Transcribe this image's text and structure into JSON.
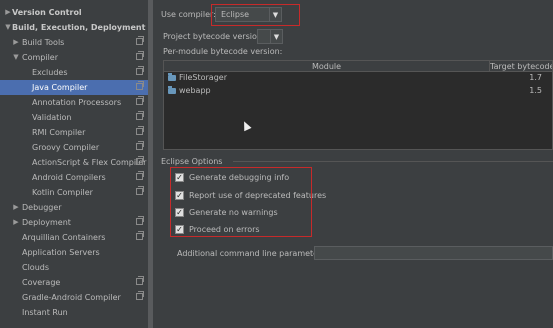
{
  "sidebar": {
    "items": [
      {
        "label": "Version Control",
        "arrow": "▶",
        "bold": true,
        "copy": false
      },
      {
        "label": "Build, Execution, Deployment",
        "arrow": "▼",
        "bold": true,
        "copy": false
      },
      {
        "label": "Build Tools",
        "arrow": "▶",
        "bold": false,
        "copy": true
      },
      {
        "label": "Compiler",
        "arrow": "▼",
        "bold": false,
        "copy": true
      },
      {
        "label": "Excludes",
        "arrow": "",
        "bold": false,
        "copy": true
      },
      {
        "label": "Java Compiler",
        "arrow": "",
        "bold": false,
        "copy": true,
        "selected": true
      },
      {
        "label": "Annotation Processors",
        "arrow": "",
        "bold": false,
        "copy": true
      },
      {
        "label": "Validation",
        "arrow": "",
        "bold": false,
        "copy": true
      },
      {
        "label": "RMI Compiler",
        "arrow": "",
        "bold": false,
        "copy": true
      },
      {
        "label": "Groovy Compiler",
        "arrow": "",
        "bold": false,
        "copy": true
      },
      {
        "label": "ActionScript & Flex Compiler",
        "arrow": "",
        "bold": false,
        "copy": true
      },
      {
        "label": "Android Compilers",
        "arrow": "",
        "bold": false,
        "copy": true
      },
      {
        "label": "Kotlin Compiler",
        "arrow": "",
        "bold": false,
        "copy": true
      },
      {
        "label": "Debugger",
        "arrow": "▶",
        "bold": false,
        "copy": false
      },
      {
        "label": "Deployment",
        "arrow": "▶",
        "bold": false,
        "copy": true
      },
      {
        "label": "Arquillian Containers",
        "arrow": "",
        "bold": false,
        "copy": true
      },
      {
        "label": "Application Servers",
        "arrow": "",
        "bold": false,
        "copy": false
      },
      {
        "label": "Clouds",
        "arrow": "",
        "bold": false,
        "copy": false
      },
      {
        "label": "Coverage",
        "arrow": "",
        "bold": false,
        "copy": true
      },
      {
        "label": "Gradle-Android Compiler",
        "arrow": "",
        "bold": false,
        "copy": true
      },
      {
        "label": "Instant Run",
        "arrow": "",
        "bold": false,
        "copy": false
      }
    ]
  },
  "main": {
    "use_compiler_label": "Use compiler:",
    "compiler_value": "Eclipse",
    "project_bytecode_label": "Project bytecode version:",
    "project_bytecode_value": "",
    "per_module_label": "Per-module bytecode version:",
    "table": {
      "headers": [
        "Module",
        "Target bytecode v"
      ],
      "rows": [
        {
          "module": "FileStorager",
          "version": "1.7"
        },
        {
          "module": "webapp",
          "version": "1.5"
        }
      ]
    },
    "eclipse_options_label": "Eclipse Options",
    "options": [
      {
        "label": "Generate debugging info",
        "checked": true
      },
      {
        "label": "Report use of deprecated features",
        "checked": true
      },
      {
        "label": "Generate no warnings",
        "checked": true
      },
      {
        "label": "Proceed on errors",
        "checked": true
      }
    ],
    "additional_params_label": "Additional command line parameters:",
    "additional_params_value": ""
  },
  "colors": {
    "selection": "#4b6eaf",
    "highlight_box": "#c72a2a",
    "background": "#3c3f41"
  }
}
